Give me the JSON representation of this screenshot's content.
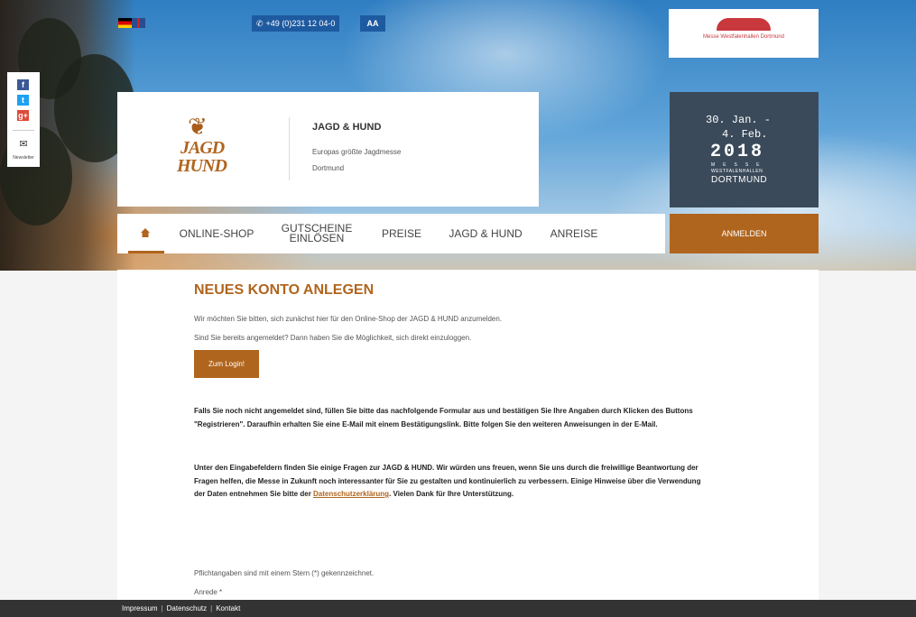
{
  "header": {
    "phone_label": "+49 (0)231 12 04-0",
    "font_size_label": "AA",
    "messe_name": "Messe Westfalenhallen Dortmund"
  },
  "social": {
    "facebook_label": "f",
    "twitter_label": "t",
    "googleplus_label": "g+",
    "mail_glyph": "✉",
    "newsletter_label": "Newsletter"
  },
  "event": {
    "logo_line1": "JAGD",
    "logo_line2": "HUND",
    "title": "JAGD & HUND",
    "subtitle": "Europas größte Jagdmesse",
    "city": "Dortmund",
    "date_line1": "30. Jan. -",
    "date_line2": "4. Feb.",
    "year": "2018",
    "date_messe": "MESSE",
    "date_west": "WESTFALENHALLEN",
    "date_city": "DORTMUND"
  },
  "nav": {
    "items": [
      "ONLINE-SHOP",
      "GUTSCHEINE EINLÖSEN",
      "PREISE",
      "JAGD & HUND",
      "ANREISE"
    ],
    "login_label": "ANMELDEN"
  },
  "main": {
    "heading": "NEUES KONTO ANLEGEN",
    "intro1": "Wir möchten Sie bitten, sich zunächst hier für den Online-Shop der JAGD & HUND anzumelden.",
    "intro2": "Sind Sie bereits angemeldet? Dann haben Sie die Möglichkeit, sich direkt einzuloggen.",
    "login_button": "Zum Login!",
    "para1": "Falls Sie noch nicht angemeldet sind, füllen Sie bitte das nachfolgende Formular aus und bestätigen Sie Ihre Angaben durch Klicken des Buttons \"Registrieren\". Daraufhin erhalten Sie eine E-Mail mit einem Bestätigungslink. Bitte folgen Sie den weiteren Anweisungen in der E-Mail.",
    "para2_text": "Unter den Eingabefeldern finden Sie einige Fragen zur JAGD & HUND. Wir würden uns freuen, wenn Sie uns durch die freiwillige Beantwortung der Fragen helfen, die Messe in Zukunft noch interessanter für Sie zu gestalten und kontinuierlich zu verbessern. Einige Hinweise über die Verwendung der Daten entnehmen Sie bitte der ",
    "privacy_link": "Datenschutzerklärung",
    "para2_end": ". Vielen Dank für Ihre Unterstützung.",
    "required_note": "Pflichtangaben sind mit einem Stern (*) gekennzeichnet.",
    "anrede_label": "Anrede *"
  },
  "footer": {
    "impressum": "Impressum",
    "datenschutz": "Datenschutz",
    "kontakt": "Kontakt",
    "separator": "|"
  }
}
